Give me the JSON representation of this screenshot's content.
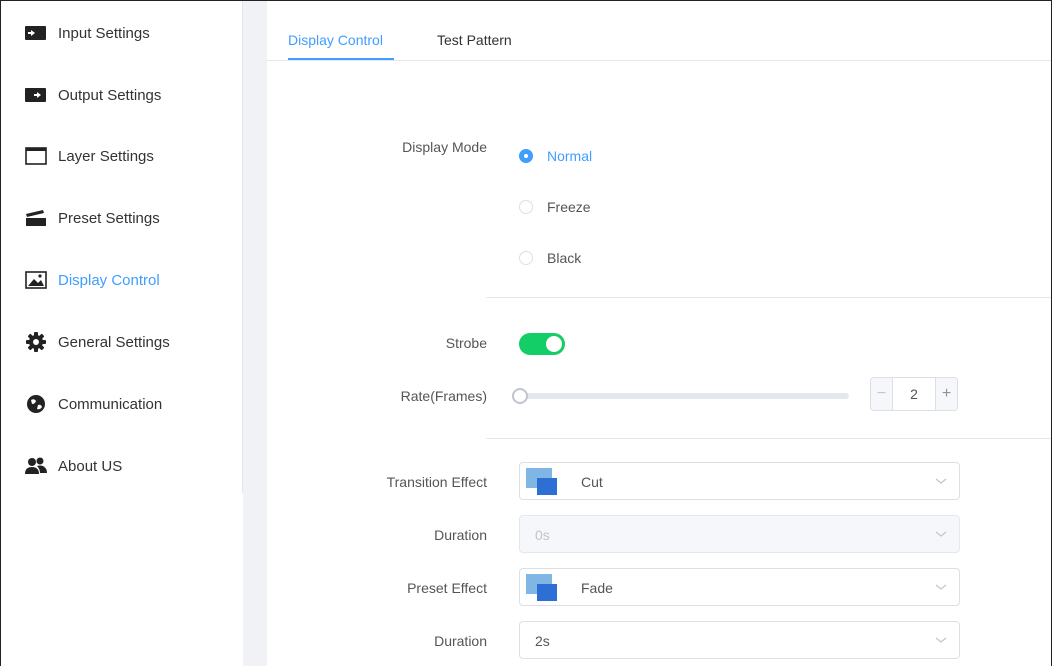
{
  "sidebar": {
    "items": [
      {
        "label": "Input Settings",
        "icon": "input-icon",
        "active": false
      },
      {
        "label": "Output Settings",
        "icon": "output-icon",
        "active": false
      },
      {
        "label": "Layer Settings",
        "icon": "layer-icon",
        "active": false
      },
      {
        "label": "Preset Settings",
        "icon": "clapperboard-icon",
        "active": false
      },
      {
        "label": "Display Control",
        "icon": "image-icon",
        "active": true
      },
      {
        "label": "General Settings",
        "icon": "gear-icon",
        "active": false
      },
      {
        "label": "Communication",
        "icon": "globe-icon",
        "active": false
      },
      {
        "label": "About US",
        "icon": "users-icon",
        "active": false
      }
    ]
  },
  "tabs": [
    {
      "label": "Display Control",
      "active": true
    },
    {
      "label": "Test Pattern",
      "active": false
    }
  ],
  "form": {
    "display_mode": {
      "label": "Display Mode",
      "options": [
        "Normal",
        "Freeze",
        "Black"
      ],
      "selected": "Normal"
    },
    "strobe": {
      "label": "Strobe",
      "on": true
    },
    "rate": {
      "label": "Rate(Frames)",
      "value": "2",
      "slider_fraction": 0.0
    },
    "transition_effect": {
      "label": "Transition Effect",
      "value": "Cut"
    },
    "transition_duration": {
      "label": "Duration",
      "value": "0s",
      "disabled": true
    },
    "preset_effect": {
      "label": "Preset Effect",
      "value": "Fade"
    },
    "preset_duration": {
      "label": "Duration",
      "value": "2s"
    }
  },
  "colors": {
    "accent": "#409eff",
    "switch_on": "#13ce66",
    "effect_icon_light": "#7fb6e4",
    "effect_icon_dark": "#2e6fd6"
  }
}
